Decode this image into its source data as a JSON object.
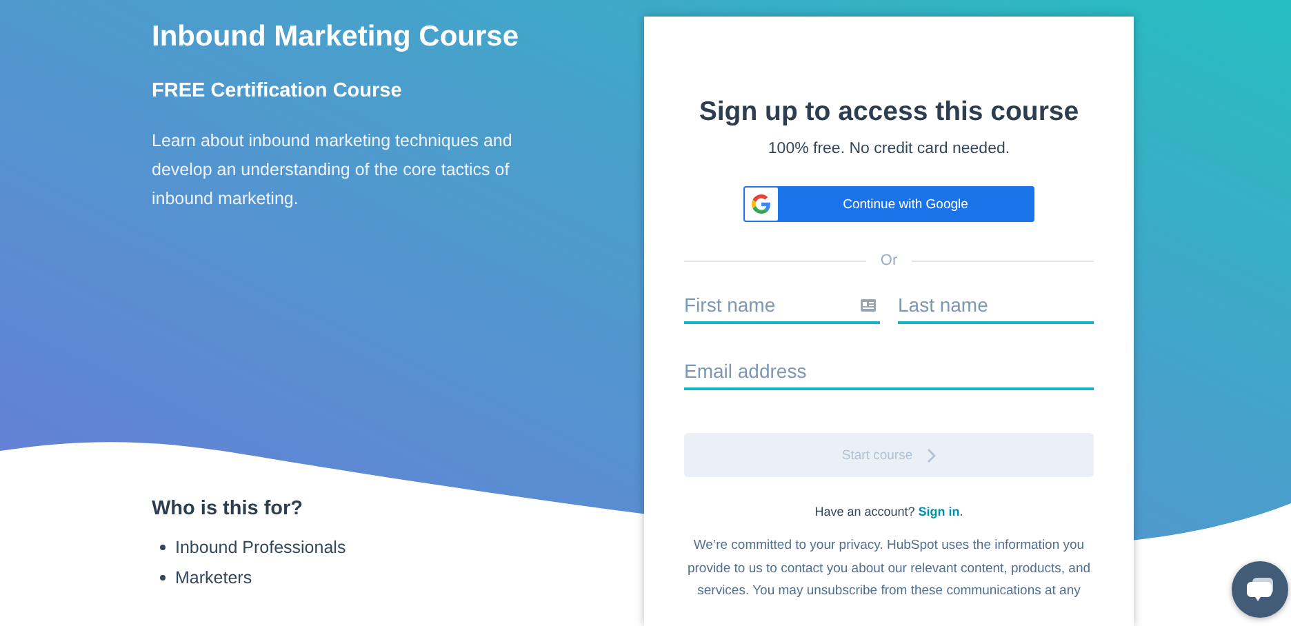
{
  "hero": {
    "title": "Inbound Marketing Course",
    "subtitle": "FREE Certification Course",
    "description": "Learn about inbound marketing techniques and develop an understanding of the core tactics of inbound marketing."
  },
  "audience": {
    "heading": "Who is this for?",
    "items": [
      "Inbound Professionals",
      "Marketers"
    ]
  },
  "signup": {
    "title": "Sign up to access this course",
    "subtitle": "100% free. No credit card needed.",
    "google_button": "Continue with Google",
    "divider": "Or",
    "fields": [
      {
        "placeholder": "First name",
        "autofill_icon": true
      },
      {
        "placeholder": "Last name",
        "autofill_icon": false
      },
      {
        "placeholder": "Email address",
        "autofill_icon": false
      }
    ],
    "submit": {
      "label": "Start course",
      "disabled": true
    },
    "account_prompt": "Have an account? **Sign in**.",
    "privacy": "We’re committed to your privacy. HubSpot uses the information you provide to us to contact you about our relevant content, products, and services. You may unsubscribe from these communications at any"
  }
}
